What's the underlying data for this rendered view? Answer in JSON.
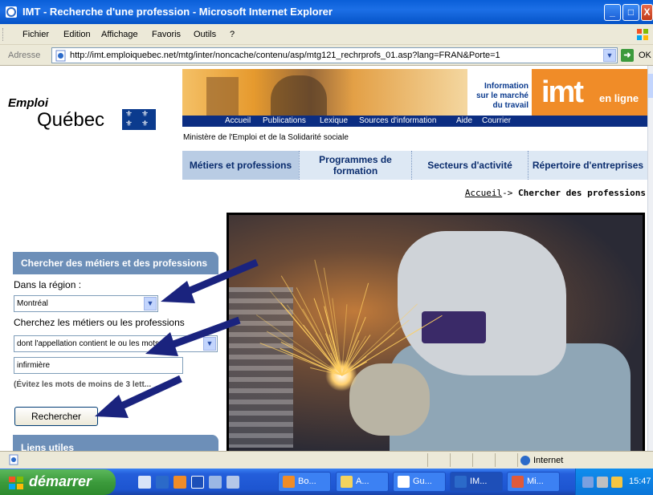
{
  "window": {
    "title": "IMT - Recherche d'une profession - Microsoft Internet Explorer",
    "min_glyph": "_",
    "max_glyph": "□",
    "close_glyph": "X"
  },
  "menu": {
    "items": [
      "Fichier",
      "Edition",
      "Affichage",
      "Favoris",
      "Outils",
      "?"
    ]
  },
  "address": {
    "label": "Adresse",
    "url": "http://imt.emploiquebec.net/mtg/inter/noncache/contenu/asp/mtg121_rechrprofs_01.asp?lang=FRAN&Porte=1",
    "go_label": "OK"
  },
  "site": {
    "logo_emploi": "Emploi",
    "logo_quebec": "Québec",
    "info_line1": "Information",
    "info_line2": "sur le marché",
    "info_line3": "du travail",
    "imt_word": "imt",
    "imt_enligne": "en ligne",
    "nav": [
      "Accueil",
      "Publications",
      "Lexique",
      "Sources d'information",
      "Aide",
      "Courrier"
    ],
    "ministere": "Ministère de l'Emploi et de la Solidarité sociale",
    "tabs": [
      {
        "label": "Métiers et professions"
      },
      {
        "label": "Programmes de formation"
      },
      {
        "label": "Secteurs d'activité"
      },
      {
        "label": "Répertoire d'entreprises"
      }
    ],
    "breadcrumb_home": "Accueil",
    "breadcrumb_sep": "-> ",
    "breadcrumb_current": "Chercher des professions"
  },
  "search": {
    "heading": "Chercher des métiers et des professions",
    "region_label": "Dans la région :",
    "region_value": "Montréal",
    "search_label": "Cherchez les métiers ou les professions",
    "mode_value": "dont l'appellation contient le ou les mots",
    "keyword_value": "infirmière",
    "hint": "(Évitez les mots de moins de 3 lett...",
    "button_label": "Rechercher",
    "links_heading": "Liens utiles"
  },
  "status": {
    "zone": "Internet"
  },
  "taskbar": {
    "start_label": "démarrer",
    "buttons": [
      "Bo...",
      "A...",
      "Gu...",
      "IM...",
      "Mi..."
    ],
    "clock": "15:47"
  },
  "colors": {
    "titlebar": "#0a5fd8",
    "nav_blue": "#0b2d82",
    "imt_orange": "#f08c28",
    "panel_blue": "#6d8fb8",
    "arrow_navy": "#1a237e"
  }
}
